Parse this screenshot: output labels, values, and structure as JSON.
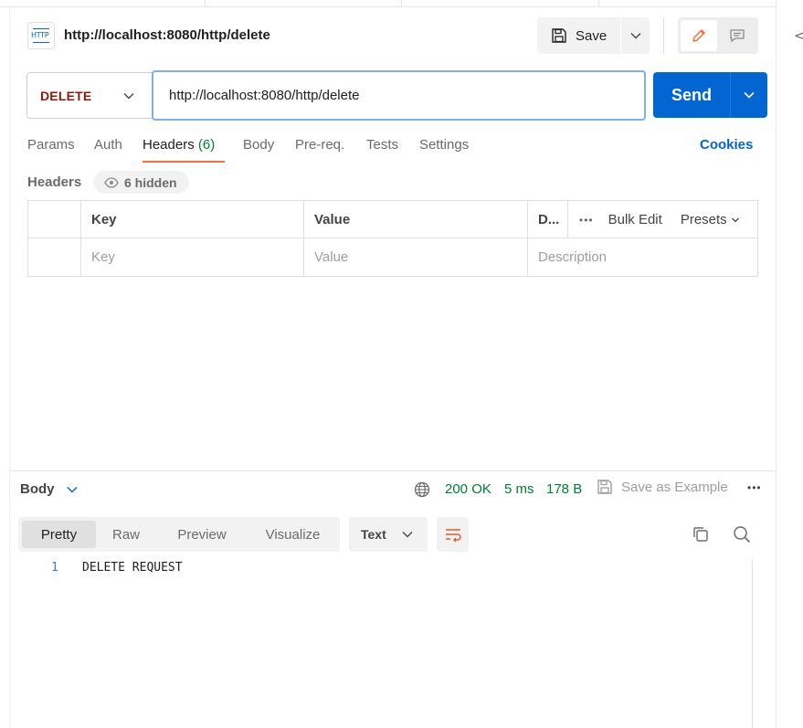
{
  "request": {
    "title": "http://localhost:8080/http/delete",
    "badge": "HTTP",
    "method": "DELETE",
    "url": "http://localhost:8080/http/delete",
    "save_label": "Save",
    "send_label": "Send"
  },
  "request_tabs": {
    "params": "Params",
    "auth": "Auth",
    "headers": "Headers",
    "headers_count": "(6)",
    "body": "Body",
    "prereq": "Pre-req.",
    "tests": "Tests",
    "settings": "Settings",
    "cookies": "Cookies"
  },
  "headers_section": {
    "title": "Headers",
    "hidden": "6 hidden",
    "columns": {
      "key": "Key",
      "value": "Value",
      "description": "D..."
    },
    "tools": {
      "more": "•••",
      "bulk_edit": "Bulk Edit",
      "presets": "Presets"
    },
    "placeholders": {
      "key": "Key",
      "value": "Value",
      "description": "Description"
    }
  },
  "response": {
    "section_label": "Body",
    "status": "200 OK",
    "time": "5 ms",
    "size": "178 B",
    "save_example": "Save as Example",
    "more": "•••",
    "views": [
      "Pretty",
      "Raw",
      "Preview",
      "Visualize"
    ],
    "active_view": "Pretty",
    "format": "Text",
    "lines": [
      {
        "num": "1",
        "text": "DELETE REQUEST"
      }
    ]
  },
  "colors": {
    "accent": "#ff6c37",
    "primary": "#0265d2",
    "method": "#8e1a10",
    "success": "#007f31"
  }
}
